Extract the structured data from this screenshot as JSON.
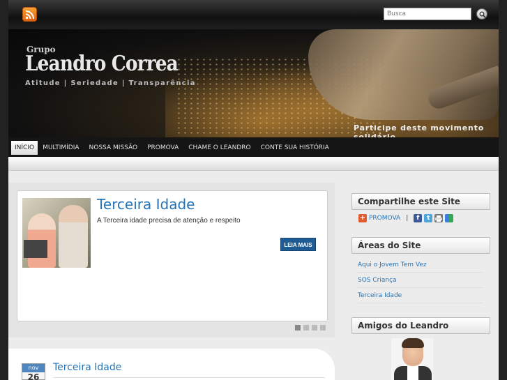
{
  "topbar": {
    "rss_icon": "rss-feed-icon",
    "search_placeholder": "Busca",
    "search_icon": "magnifier-icon"
  },
  "header": {
    "brand_prefix": "Grupo",
    "brand_name": "Leandro Correa",
    "tagline": "Atitude | Seriedade | Transparência",
    "cta": "Participe deste movimento solidário"
  },
  "nav": {
    "items": [
      "INÍCIO",
      "MULTIMÍDIA",
      "NOSSA MISSÃO",
      "PROMOVA",
      "CHAME O LEANDRO",
      "CONTE SUA HISTÓRIA"
    ],
    "active_index": 0
  },
  "slider": {
    "title": "Terceira Idade",
    "description": "A Terceira idade precisa de atenção e respeito",
    "read_more": "LEIA MAIS",
    "slide_count": 4,
    "active_slide": 1
  },
  "post": {
    "month": "nov",
    "day": "26",
    "title": "Terceira Idade"
  },
  "sidebar": {
    "share": {
      "heading": "Compartilhe este Site",
      "promova": "PROMOVA",
      "separator": "|",
      "icons": [
        "facebook-icon",
        "twitter-icon",
        "printer-icon",
        "google-icon"
      ]
    },
    "areas": {
      "heading": "Áreas do Site",
      "items": [
        "Aqui o Jovem Tem Vez",
        "SOS Criança",
        "Terceira Idade"
      ]
    },
    "friends": {
      "heading": "Amigos do Leandro"
    }
  },
  "colors": {
    "link_blue": "#2673b5",
    "button_blue": "#1f5c94",
    "nav_bg": "#151515"
  }
}
